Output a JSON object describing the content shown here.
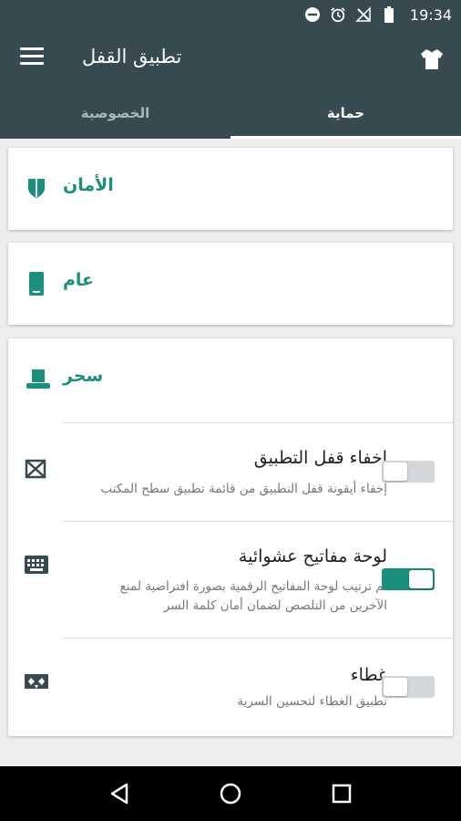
{
  "status_bar": {
    "time": "19:34",
    "icons": [
      "dnd-icon",
      "alarm-icon",
      "no-signal-icon",
      "battery-icon"
    ]
  },
  "app_bar": {
    "title": "تطبيق القفل",
    "menu_icon": "menu-icon",
    "theme_icon": "shirt-icon"
  },
  "tabs": [
    {
      "label": "الخصوصية",
      "active": false
    },
    {
      "label": "حماية",
      "active": true
    }
  ],
  "cards": {
    "security": {
      "title": "الأمان",
      "icon": "shield-icon"
    },
    "general": {
      "title": "عام",
      "icon": "phone-icon"
    },
    "magic": {
      "title": "سحر",
      "icon": "magic-hat-icon",
      "items": [
        {
          "title": "إخفاء قفل التطبيق",
          "description": "إخفاء أيقونة قفل التطبيق من قائمة تطبيق سطح المكتب",
          "icon": "envelope-icon",
          "enabled": false
        },
        {
          "title": "لوحة مفاتيح عشوائية",
          "description_line1": "تم ترتيب لوحة المفاتيح الرقمية بصورة افتراضية لمنع",
          "description_line2": "الآخرين من التلصص لضمان أمان كلمة السر",
          "icon": "keyboard-icon",
          "enabled": true
        },
        {
          "title": "غطاء",
          "description": "تطبيق الغطاء لتحسين السرية",
          "icon": "mask-icon",
          "enabled": false
        }
      ]
    }
  },
  "colors": {
    "primary": "#374a52",
    "accent": "#1b8f7e",
    "background": "#eeeeee"
  },
  "nav_bar": [
    "back-icon",
    "home-icon",
    "recents-icon"
  ]
}
